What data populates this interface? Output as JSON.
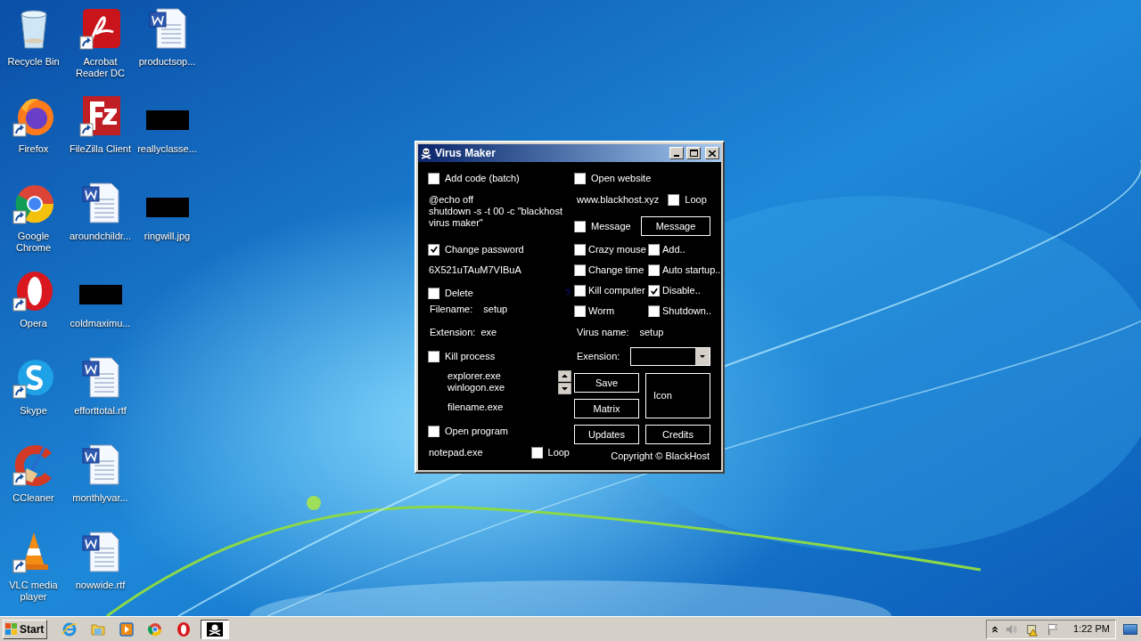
{
  "desktop": {
    "icons": [
      {
        "label": "Recycle Bin",
        "kind": "recycle"
      },
      {
        "label": "Firefox",
        "kind": "firefox"
      },
      {
        "label": "Google Chrome",
        "kind": "chrome"
      },
      {
        "label": "Opera",
        "kind": "opera"
      },
      {
        "label": "Skype",
        "kind": "skype"
      },
      {
        "label": "CCleaner",
        "kind": "ccleaner"
      },
      {
        "label": "VLC media player",
        "kind": "vlc"
      },
      {
        "label": "Acrobat Reader DC",
        "kind": "acrobat"
      },
      {
        "label": "FileZilla Client",
        "kind": "filezilla"
      },
      {
        "label": "aroundchildr...",
        "kind": "document"
      },
      {
        "label": "coldmaximu...",
        "kind": "redacted"
      },
      {
        "label": "efforttotal.rtf",
        "kind": "document"
      },
      {
        "label": "monthlyvar...",
        "kind": "document"
      },
      {
        "label": "nowwide.rtf",
        "kind": "document"
      },
      {
        "label": "productsop...",
        "kind": "document"
      },
      {
        "label": "reallyclasse...",
        "kind": "redacted"
      },
      {
        "label": "ringwill.jpg",
        "kind": "redacted"
      }
    ]
  },
  "window": {
    "title": "Virus Maker",
    "add_code": {
      "label": "Add code (batch)",
      "checked": false
    },
    "batch_code": [
      "@echo off",
      "shutdown -s -t 00 -c \"blackhost",
      "virus maker\""
    ],
    "change_password": {
      "label": "Change password",
      "checked": true
    },
    "password": "6X521uTAuM7VIBuA",
    "delete": {
      "label": "Delete",
      "checked": false
    },
    "help_link": "?",
    "filename": {
      "label": "Filename:",
      "value": "setup"
    },
    "extension": {
      "label": "Extension:",
      "value": "exe"
    },
    "kill_process": {
      "label": "Kill process",
      "checked": false
    },
    "processes": [
      "explorer.exe",
      "winlogon.exe"
    ],
    "process_input": "filename.exe",
    "open_program": {
      "label": "Open program",
      "checked": false
    },
    "program": "notepad.exe",
    "program_loop": {
      "label": "Loop",
      "checked": false
    },
    "open_website": {
      "label": "Open website",
      "checked": false
    },
    "website": "www.blackhost.xyz",
    "website_loop": {
      "label": "Loop",
      "checked": false
    },
    "message": {
      "label": "Message",
      "checked": false
    },
    "message_button": "Message",
    "options": [
      {
        "label": "Crazy mouse",
        "checked": false
      },
      {
        "label": "Add..",
        "checked": false
      },
      {
        "label": "Change time",
        "checked": false
      },
      {
        "label": "Auto startup..",
        "checked": false
      },
      {
        "label": "Kill computer",
        "checked": false
      },
      {
        "label": "Disable..",
        "checked": true
      },
      {
        "label": "Worm",
        "checked": false
      },
      {
        "label": "Shutdown..",
        "checked": false
      }
    ],
    "virus_name": {
      "label": "Virus name:",
      "value": "setup"
    },
    "exension": {
      "label": "Exension:"
    },
    "save_button": "Save",
    "matrix_button": "Matrix",
    "icon_button": "Icon",
    "updates_button": "Updates",
    "credits_button": "Credits",
    "copyright": "Copyright © BlackHost"
  },
  "taskbar": {
    "start": "Start",
    "pinned": [
      {
        "kind": "ie"
      },
      {
        "kind": "folder"
      },
      {
        "kind": "media"
      },
      {
        "kind": "chrome"
      },
      {
        "kind": "opera"
      }
    ],
    "clock": "1:22 PM"
  }
}
